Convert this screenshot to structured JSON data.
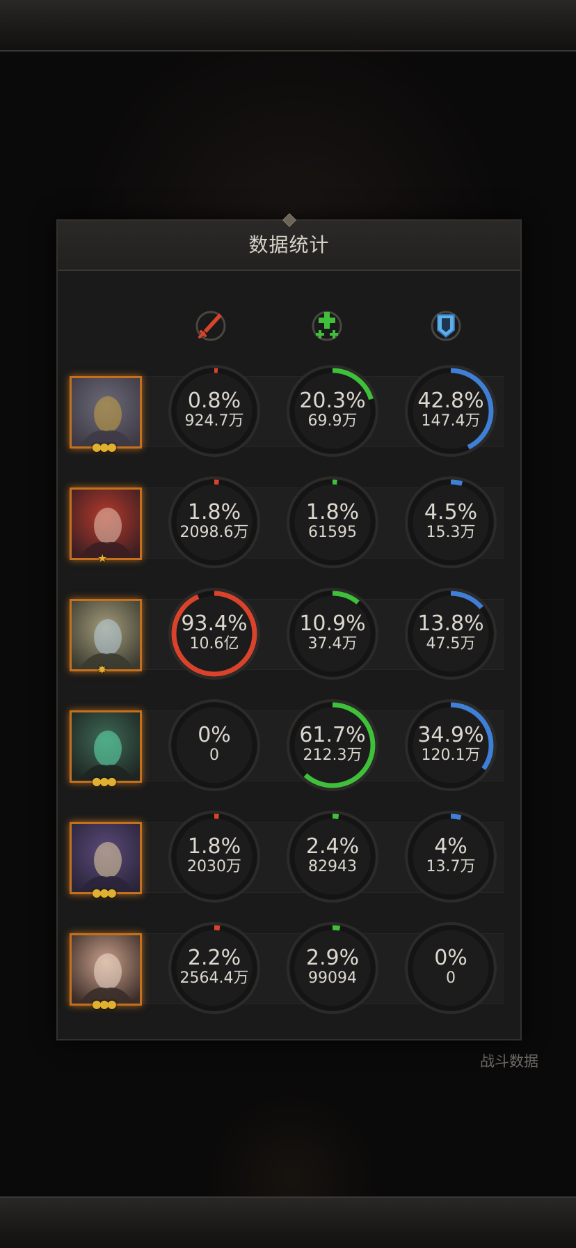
{
  "background_label": "战斗数据",
  "panel": {
    "title": "数据统计"
  },
  "columns": [
    {
      "icon": "sword-damage-icon",
      "color": "#d9432b"
    },
    {
      "icon": "heal-cross-icon",
      "color": "#3fbf3a"
    },
    {
      "icon": "shield-defense-icon",
      "color": "#3f7fd6"
    }
  ],
  "heroes": [
    {
      "portrait": "dragon-beast-portrait",
      "stars": "●●●",
      "stats": [
        {
          "pct": "0.8%",
          "amount": "924.7万",
          "fraction": 0.008
        },
        {
          "pct": "20.3%",
          "amount": "69.9万",
          "fraction": 0.203
        },
        {
          "pct": "42.8%",
          "amount": "147.4万",
          "fraction": 0.428
        }
      ]
    },
    {
      "portrait": "red-hair-woman-portrait",
      "stars": "★",
      "stats": [
        {
          "pct": "1.8%",
          "amount": "2098.6万",
          "fraction": 0.018
        },
        {
          "pct": "1.8%",
          "amount": "61595",
          "fraction": 0.018
        },
        {
          "pct": "4.5%",
          "amount": "15.3万",
          "fraction": 0.045
        }
      ]
    },
    {
      "portrait": "crowned-elf-portrait",
      "stars": "✸",
      "stats": [
        {
          "pct": "93.4%",
          "amount": "10.6亿",
          "fraction": 0.934
        },
        {
          "pct": "10.9%",
          "amount": "37.4万",
          "fraction": 0.109
        },
        {
          "pct": "13.8%",
          "amount": "47.5万",
          "fraction": 0.138
        }
      ]
    },
    {
      "portrait": "antler-druid-portrait",
      "stars": "●●●",
      "stats": [
        {
          "pct": "0%",
          "amount": "0",
          "fraction": 0
        },
        {
          "pct": "61.7%",
          "amount": "212.3万",
          "fraction": 0.617
        },
        {
          "pct": "34.9%",
          "amount": "120.1万",
          "fraction": 0.349
        }
      ]
    },
    {
      "portrait": "hooded-girl-portrait",
      "stars": "●●●",
      "stats": [
        {
          "pct": "1.8%",
          "amount": "2030万",
          "fraction": 0.018
        },
        {
          "pct": "2.4%",
          "amount": "82943",
          "fraction": 0.024
        },
        {
          "pct": "4%",
          "amount": "13.7万",
          "fraction": 0.04
        }
      ]
    },
    {
      "portrait": "blonde-woman-portrait",
      "stars": "●●●",
      "stats": [
        {
          "pct": "2.2%",
          "amount": "2564.4万",
          "fraction": 0.022
        },
        {
          "pct": "2.9%",
          "amount": "99094",
          "fraction": 0.029
        },
        {
          "pct": "0%",
          "amount": "0",
          "fraction": 0
        }
      ]
    }
  ]
}
